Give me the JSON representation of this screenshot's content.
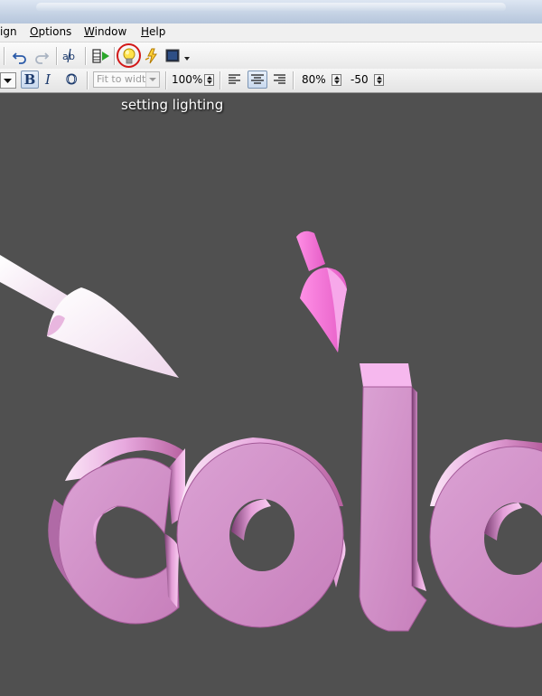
{
  "menu": {
    "items": [
      {
        "label": "ign",
        "underline": ""
      },
      {
        "label": "Options",
        "underline": "O"
      },
      {
        "label": "Window",
        "underline": "W"
      },
      {
        "label": "Help",
        "underline": "H"
      }
    ]
  },
  "toolbar": {
    "highlighted_tool": "lightbulb-icon",
    "highlight_color": "#d21818"
  },
  "format_toolbar": {
    "fit_dropdown": "Fit to width",
    "zoom": "100%",
    "intensity": "80%",
    "depth": "-50"
  },
  "caption": "setting lighting",
  "canvas": {
    "background": "#505050",
    "text_3d": "colo",
    "text_color": "#d48cc8"
  },
  "colors": {
    "menu_bg": "#f0f0f0",
    "toolbar_accent": "#1d3b6d"
  }
}
